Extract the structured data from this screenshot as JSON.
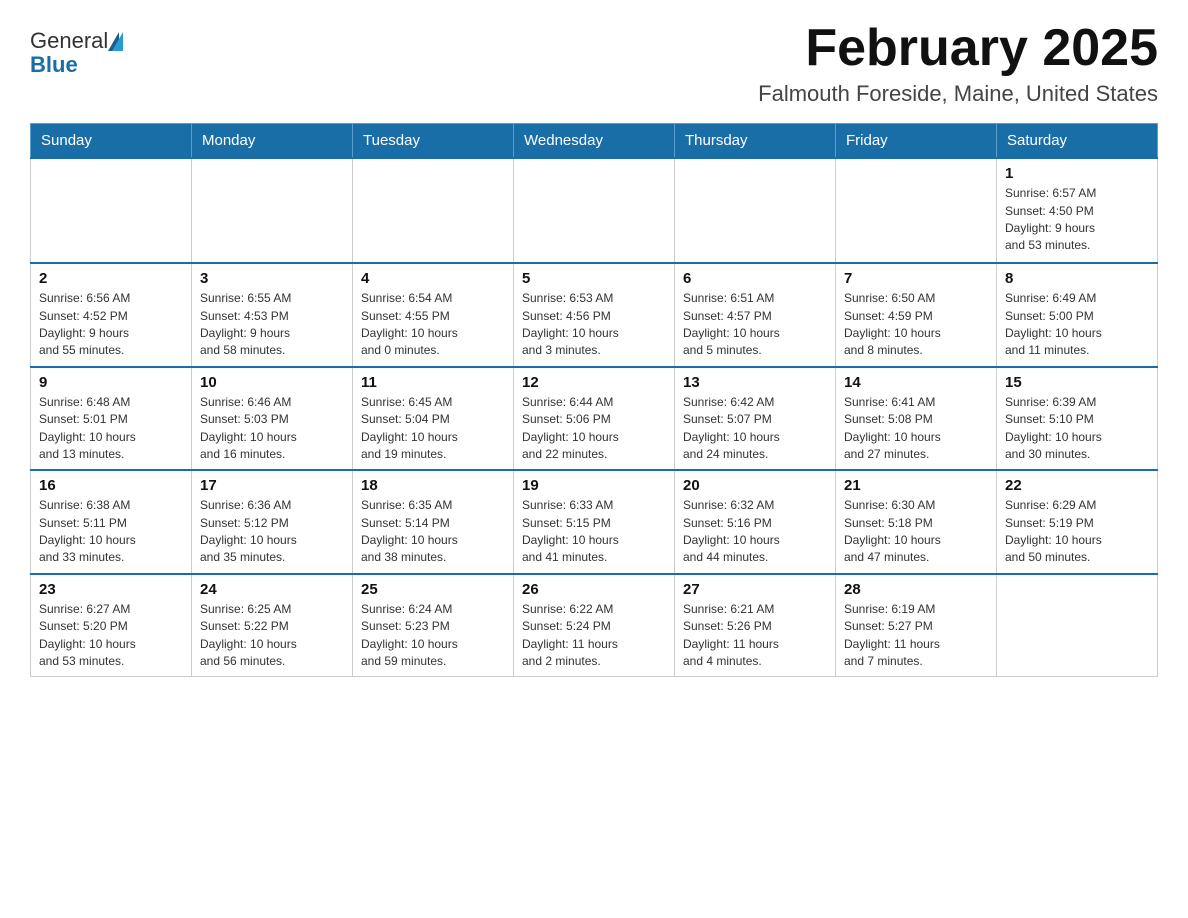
{
  "header": {
    "logo_general": "General",
    "logo_blue": "Blue",
    "month_title": "February 2025",
    "location": "Falmouth Foreside, Maine, United States"
  },
  "weekdays": [
    "Sunday",
    "Monday",
    "Tuesday",
    "Wednesday",
    "Thursday",
    "Friday",
    "Saturday"
  ],
  "weeks": [
    [
      {
        "day": "",
        "info": ""
      },
      {
        "day": "",
        "info": ""
      },
      {
        "day": "",
        "info": ""
      },
      {
        "day": "",
        "info": ""
      },
      {
        "day": "",
        "info": ""
      },
      {
        "day": "",
        "info": ""
      },
      {
        "day": "1",
        "info": "Sunrise: 6:57 AM\nSunset: 4:50 PM\nDaylight: 9 hours\nand 53 minutes."
      }
    ],
    [
      {
        "day": "2",
        "info": "Sunrise: 6:56 AM\nSunset: 4:52 PM\nDaylight: 9 hours\nand 55 minutes."
      },
      {
        "day": "3",
        "info": "Sunrise: 6:55 AM\nSunset: 4:53 PM\nDaylight: 9 hours\nand 58 minutes."
      },
      {
        "day": "4",
        "info": "Sunrise: 6:54 AM\nSunset: 4:55 PM\nDaylight: 10 hours\nand 0 minutes."
      },
      {
        "day": "5",
        "info": "Sunrise: 6:53 AM\nSunset: 4:56 PM\nDaylight: 10 hours\nand 3 minutes."
      },
      {
        "day": "6",
        "info": "Sunrise: 6:51 AM\nSunset: 4:57 PM\nDaylight: 10 hours\nand 5 minutes."
      },
      {
        "day": "7",
        "info": "Sunrise: 6:50 AM\nSunset: 4:59 PM\nDaylight: 10 hours\nand 8 minutes."
      },
      {
        "day": "8",
        "info": "Sunrise: 6:49 AM\nSunset: 5:00 PM\nDaylight: 10 hours\nand 11 minutes."
      }
    ],
    [
      {
        "day": "9",
        "info": "Sunrise: 6:48 AM\nSunset: 5:01 PM\nDaylight: 10 hours\nand 13 minutes."
      },
      {
        "day": "10",
        "info": "Sunrise: 6:46 AM\nSunset: 5:03 PM\nDaylight: 10 hours\nand 16 minutes."
      },
      {
        "day": "11",
        "info": "Sunrise: 6:45 AM\nSunset: 5:04 PM\nDaylight: 10 hours\nand 19 minutes."
      },
      {
        "day": "12",
        "info": "Sunrise: 6:44 AM\nSunset: 5:06 PM\nDaylight: 10 hours\nand 22 minutes."
      },
      {
        "day": "13",
        "info": "Sunrise: 6:42 AM\nSunset: 5:07 PM\nDaylight: 10 hours\nand 24 minutes."
      },
      {
        "day": "14",
        "info": "Sunrise: 6:41 AM\nSunset: 5:08 PM\nDaylight: 10 hours\nand 27 minutes."
      },
      {
        "day": "15",
        "info": "Sunrise: 6:39 AM\nSunset: 5:10 PM\nDaylight: 10 hours\nand 30 minutes."
      }
    ],
    [
      {
        "day": "16",
        "info": "Sunrise: 6:38 AM\nSunset: 5:11 PM\nDaylight: 10 hours\nand 33 minutes."
      },
      {
        "day": "17",
        "info": "Sunrise: 6:36 AM\nSunset: 5:12 PM\nDaylight: 10 hours\nand 35 minutes."
      },
      {
        "day": "18",
        "info": "Sunrise: 6:35 AM\nSunset: 5:14 PM\nDaylight: 10 hours\nand 38 minutes."
      },
      {
        "day": "19",
        "info": "Sunrise: 6:33 AM\nSunset: 5:15 PM\nDaylight: 10 hours\nand 41 minutes."
      },
      {
        "day": "20",
        "info": "Sunrise: 6:32 AM\nSunset: 5:16 PM\nDaylight: 10 hours\nand 44 minutes."
      },
      {
        "day": "21",
        "info": "Sunrise: 6:30 AM\nSunset: 5:18 PM\nDaylight: 10 hours\nand 47 minutes."
      },
      {
        "day": "22",
        "info": "Sunrise: 6:29 AM\nSunset: 5:19 PM\nDaylight: 10 hours\nand 50 minutes."
      }
    ],
    [
      {
        "day": "23",
        "info": "Sunrise: 6:27 AM\nSunset: 5:20 PM\nDaylight: 10 hours\nand 53 minutes."
      },
      {
        "day": "24",
        "info": "Sunrise: 6:25 AM\nSunset: 5:22 PM\nDaylight: 10 hours\nand 56 minutes."
      },
      {
        "day": "25",
        "info": "Sunrise: 6:24 AM\nSunset: 5:23 PM\nDaylight: 10 hours\nand 59 minutes."
      },
      {
        "day": "26",
        "info": "Sunrise: 6:22 AM\nSunset: 5:24 PM\nDaylight: 11 hours\nand 2 minutes."
      },
      {
        "day": "27",
        "info": "Sunrise: 6:21 AM\nSunset: 5:26 PM\nDaylight: 11 hours\nand 4 minutes."
      },
      {
        "day": "28",
        "info": "Sunrise: 6:19 AM\nSunset: 5:27 PM\nDaylight: 11 hours\nand 7 minutes."
      },
      {
        "day": "",
        "info": ""
      }
    ]
  ]
}
